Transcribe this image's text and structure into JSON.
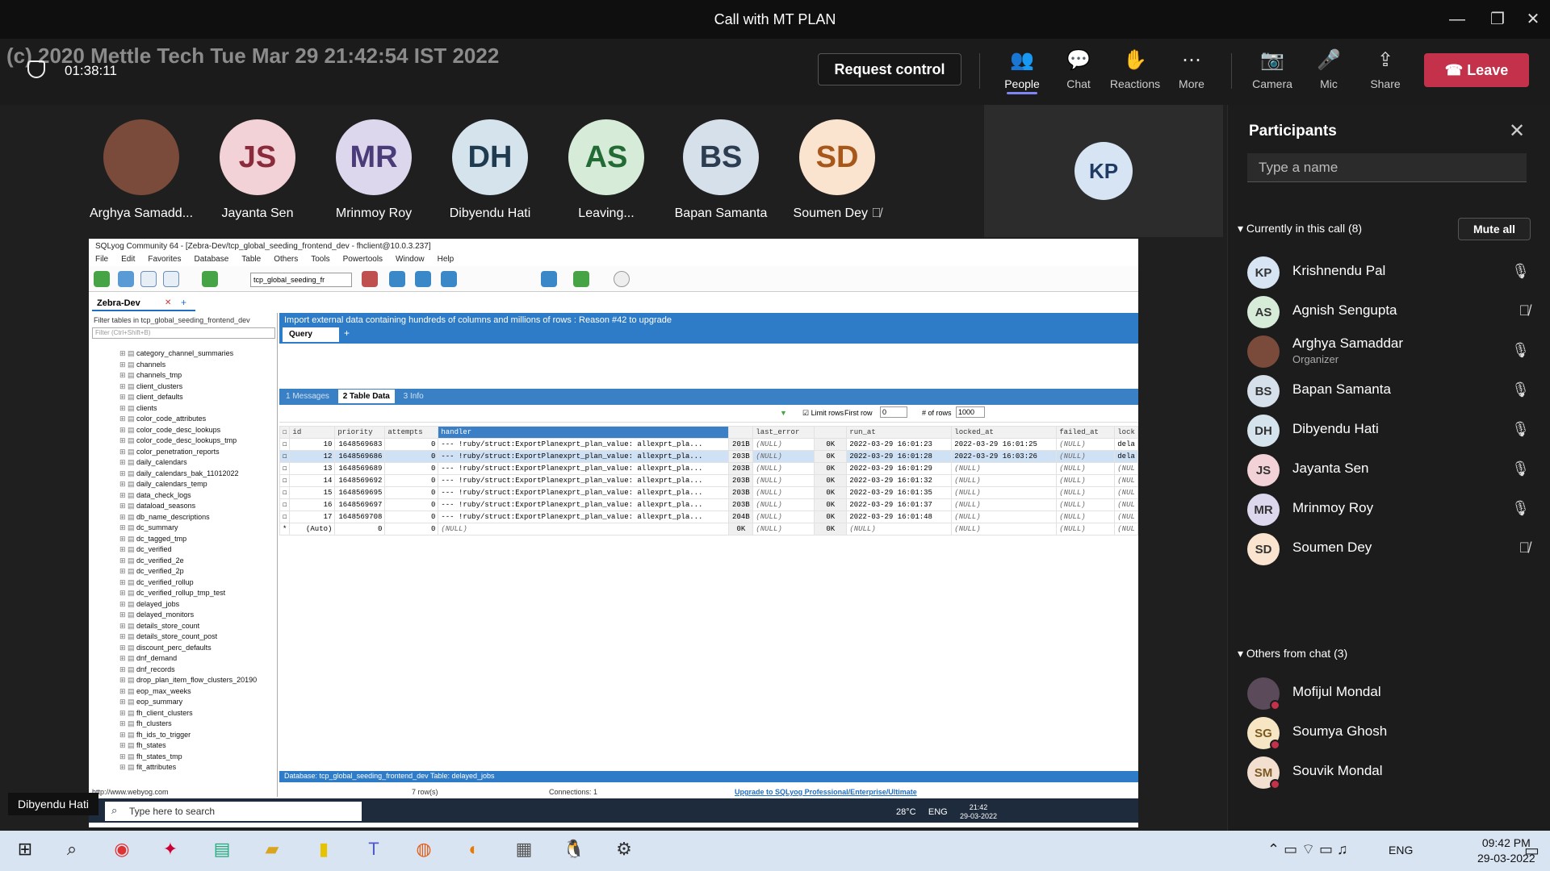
{
  "window": {
    "title": "Call with MT PLAN"
  },
  "watermark": "(c) 2020 Mettle Tech Tue Mar 29 21:42:54 IST 2022",
  "call": {
    "duration": "01:38:11",
    "request_control": "Request control",
    "leave": "Leave"
  },
  "toolbar": [
    {
      "label": "People",
      "icon": "people-icon"
    },
    {
      "label": "Chat",
      "icon": "chat-icon"
    },
    {
      "label": "Reactions",
      "icon": "reactions-icon"
    },
    {
      "label": "More",
      "icon": "more-icon"
    },
    {
      "label": "Camera",
      "icon": "camera-off-icon"
    },
    {
      "label": "Mic",
      "icon": "mic-icon"
    },
    {
      "label": "Share",
      "icon": "share-icon"
    }
  ],
  "video_tiles": [
    {
      "name": "Arghya Samadd...",
      "initials": "",
      "color": "#7a4a3a"
    },
    {
      "name": "Jayanta Sen",
      "initials": "JS",
      "color": "#f2d2d6"
    },
    {
      "name": "Mrinmoy Roy",
      "initials": "MR",
      "color": "#dcd7ec"
    },
    {
      "name": "Dibyendu Hati",
      "initials": "DH",
      "color": "#d5e3ec"
    },
    {
      "name": "Leaving...",
      "initials": "AS",
      "color": "#d6ecd9"
    },
    {
      "name": "Bapan Samanta",
      "initials": "BS",
      "color": "#d6e0ea"
    },
    {
      "name": "Soumen Dey",
      "initials": "SD",
      "color": "#fbe4cf"
    }
  ],
  "spotlight": {
    "initials": "KP"
  },
  "presenter_badge": "Dibyendu Hati",
  "sqlyog": {
    "title": "SQLyog Community 64 - [Zebra-Dev/tcp_global_seeding_frontend_dev - fhclient@10.0.3.237]",
    "menu": [
      "File",
      "Edit",
      "Favorites",
      "Database",
      "Table",
      "Others",
      "Tools",
      "Powertools",
      "Window",
      "Help"
    ],
    "db_combo": "tcp_global_seeding_fr",
    "connection_tab": "Zebra-Dev",
    "filter_header": "Filter tables in tcp_global_seeding_frontend_dev",
    "filter_placeholder": "Filter (Ctrl+Shift+B)",
    "tables": [
      "category_channel_summaries",
      "channels",
      "channels_tmp",
      "client_clusters",
      "client_defaults",
      "clients",
      "color_code_attributes",
      "color_code_desc_lookups",
      "color_code_desc_lookups_tmp",
      "color_penetration_reports",
      "daily_calendars",
      "daily_calendars_bak_11012022",
      "daily_calendars_temp",
      "data_check_logs",
      "dataload_seasons",
      "db_name_descriptions",
      "dc_summary",
      "dc_tagged_tmp",
      "dc_verified",
      "dc_verified_2e",
      "dc_verified_2p",
      "dc_verified_rollup",
      "dc_verified_rollup_tmp_test",
      "delayed_jobs",
      "delayed_monitors",
      "details_store_count",
      "details_store_count_post",
      "discount_perc_defaults",
      "dnf_demand",
      "dnf_records",
      "drop_plan_item_flow_clusters_20190",
      "eop_max_weeks",
      "eop_summary",
      "fh_client_clusters",
      "fh_clusters",
      "fh_ids_to_trigger",
      "fh_states",
      "fh_states_tmp",
      "fit_attributes"
    ],
    "banner": "Import external data containing hundreds of columns and millions of rows : Reason #42 to upgrade",
    "query_tab": "Query",
    "result_tabs": [
      "1 Messages",
      "2 Table Data",
      "3 Info"
    ],
    "limit_rows": "Limit rows",
    "first_row_label": "First row",
    "first_row": "0",
    "rows_label": "# of rows",
    "rows_value": "1000",
    "columns": [
      "id",
      "priority",
      "attempts",
      "handler",
      "",
      "last_error",
      "",
      "run_at",
      "locked_at",
      "failed_at",
      "lock"
    ],
    "rows": [
      [
        "10",
        "1648569683",
        "0",
        "--- !ruby/struct:ExportPlanexprt_plan_value: allexprt_pla...",
        "201B",
        "(NULL)",
        "0K",
        "2022-03-29 16:01:23",
        "2022-03-29 16:01:25",
        "(NULL)",
        "dela"
      ],
      [
        "12",
        "1648569686",
        "0",
        "--- !ruby/struct:ExportPlanexprt_plan_value: allexprt_pla...",
        "203B",
        "(NULL)",
        "0K",
        "2022-03-29 16:01:28",
        "2022-03-29 16:03:26",
        "(NULL)",
        "dela"
      ],
      [
        "13",
        "1648569689",
        "0",
        "--- !ruby/struct:ExportPlanexprt_plan_value: allexprt_pla...",
        "203B",
        "(NULL)",
        "0K",
        "2022-03-29 16:01:29",
        "(NULL)",
        "(NULL)",
        "(NUL"
      ],
      [
        "14",
        "1648569692",
        "0",
        "--- !ruby/struct:ExportPlanexprt_plan_value: allexprt_pla...",
        "203B",
        "(NULL)",
        "0K",
        "2022-03-29 16:01:32",
        "(NULL)",
        "(NULL)",
        "(NUL"
      ],
      [
        "15",
        "1648569695",
        "0",
        "--- !ruby/struct:ExportPlanexprt_plan_value: allexprt_pla...",
        "203B",
        "(NULL)",
        "0K",
        "2022-03-29 16:01:35",
        "(NULL)",
        "(NULL)",
        "(NUL"
      ],
      [
        "16",
        "1648569697",
        "0",
        "--- !ruby/struct:ExportPlanexprt_plan_value: allexprt_pla...",
        "203B",
        "(NULL)",
        "0K",
        "2022-03-29 16:01:37",
        "(NULL)",
        "(NULL)",
        "(NUL"
      ],
      [
        "17",
        "1648569708",
        "0",
        "--- !ruby/struct:ExportPlanexprt_plan_value: allexprt_pla...",
        "204B",
        "(NULL)",
        "0K",
        "2022-03-29 16:01:48",
        "(NULL)",
        "(NULL)",
        "(NUL"
      ],
      [
        "(Auto)",
        "0",
        "0",
        "(NULL)",
        "0K",
        "(NULL)",
        "0K",
        "(NULL)",
        "(NULL)",
        "(NULL)",
        "(NUL"
      ]
    ],
    "status_bar": "Database: tcp_global_seeding_frontend_dev    Table: delayed_jobs",
    "url": "http://www.webyog.com",
    "rows_count": "7 row(s)",
    "connections": "Connections: 1",
    "upgrade": "Upgrade to SQLyog Professional/Enterprise/Ultimate",
    "remote_search": "Type here to search",
    "remote_temp": "28°C",
    "remote_lang": "ENG",
    "remote_time": "21:42",
    "remote_date": "29-03-2022"
  },
  "panel": {
    "title": "Participants",
    "search_placeholder": "Type a name",
    "in_call_label": "Currently in this call (8)",
    "mute_all": "Mute all",
    "others_label": "Others from chat (3)",
    "in_call": [
      {
        "name": "Krishnendu Pal",
        "initials": "KP",
        "color": "#d7e4f4",
        "role": "",
        "mic": "mic-icon"
      },
      {
        "name": "Agnish Sengupta",
        "initials": "AS",
        "color": "#d6ecd9",
        "role": "",
        "mic": "mic-muted-icon"
      },
      {
        "name": "Arghya Samaddar",
        "initials": "",
        "color": "#7a4a3a",
        "role": "Organizer",
        "mic": "mic-icon"
      },
      {
        "name": "Bapan Samanta",
        "initials": "BS",
        "color": "#d6e0ea",
        "role": "",
        "mic": "mic-icon"
      },
      {
        "name": "Dibyendu Hati",
        "initials": "DH",
        "color": "#d5e3ec",
        "role": "",
        "mic": "mic-icon"
      },
      {
        "name": "Jayanta Sen",
        "initials": "JS",
        "color": "#f2d2d6",
        "role": "",
        "mic": "mic-icon"
      },
      {
        "name": "Mrinmoy Roy",
        "initials": "MR",
        "color": "#dcd7ec",
        "role": "",
        "mic": "mic-icon"
      },
      {
        "name": "Soumen Dey",
        "initials": "SD",
        "color": "#fbe4cf",
        "role": "",
        "mic": "mic-muted-icon"
      }
    ],
    "others": [
      {
        "name": "Mofijul Mondal",
        "initials": "",
        "color": "#5a4a5a"
      },
      {
        "name": "Soumya Ghosh",
        "initials": "SG",
        "color": "#f6e6c4"
      },
      {
        "name": "Souvik Mondal",
        "initials": "SM",
        "color": "#f3dfd0"
      }
    ]
  },
  "taskbar": {
    "time": "09:42 PM",
    "date": "29-03-2022",
    "lang": "ENG"
  }
}
